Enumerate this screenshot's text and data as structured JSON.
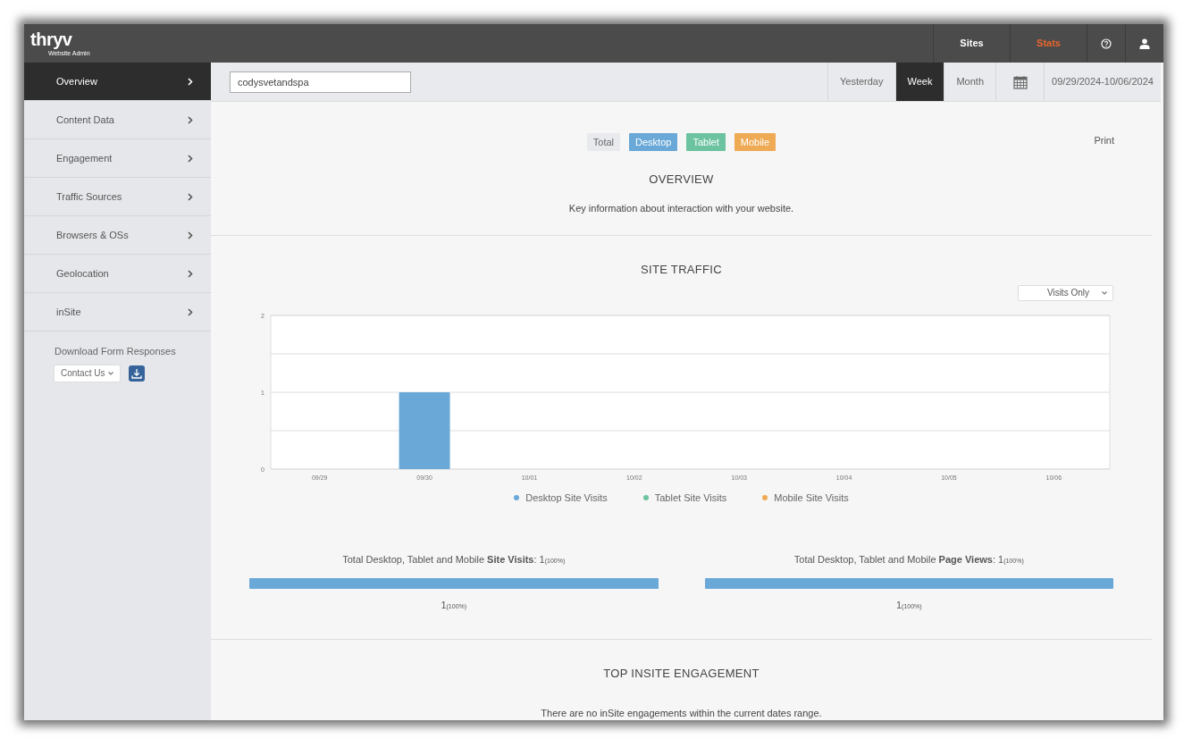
{
  "logo": {
    "name": "thryv",
    "tagline": "Website Admin"
  },
  "top_nav": [
    {
      "label": "Sites",
      "selected": false
    },
    {
      "label": "Stats",
      "selected": true
    }
  ],
  "sidebar": {
    "items": [
      {
        "label": "Overview",
        "selected": true
      },
      {
        "label": "Content Data",
        "selected": false
      },
      {
        "label": "Engagement",
        "selected": false
      },
      {
        "label": "Traffic Sources",
        "selected": false
      },
      {
        "label": "Browsers & OSs",
        "selected": false
      },
      {
        "label": "Geolocation",
        "selected": false
      },
      {
        "label": "inSite",
        "selected": false
      }
    ],
    "download": {
      "title": "Download Form Responses",
      "form_select": "Contact Us"
    }
  },
  "toolbar": {
    "site_field": "codysvetandspa",
    "ranges": [
      {
        "label": "Yesterday",
        "selected": false
      },
      {
        "label": "Week",
        "selected": true
      },
      {
        "label": "Month",
        "selected": false
      }
    ],
    "date_range": "09/29/2024-10/06/2024"
  },
  "device_filters": [
    {
      "label": "Total",
      "color": "#e9eaed"
    },
    {
      "label": "Desktop",
      "color": "#6aa8d8"
    },
    {
      "label": "Tablet",
      "color": "#6cc3a0"
    },
    {
      "label": "Mobile",
      "color": "#eeaa55"
    }
  ],
  "print": "Print",
  "overview": {
    "title": "OVERVIEW",
    "description": "Key information about interaction with your website."
  },
  "site_traffic": {
    "title": "SITE TRAFFIC",
    "mode_select": "Visits Only",
    "chart_data": {
      "type": "bar",
      "categories": [
        "09/29",
        "09/30",
        "10/01",
        "10/02",
        "10/03",
        "10/04",
        "10/05",
        "10/06"
      ],
      "series": [
        {
          "name": "Desktop Site Visits",
          "color": "#6aa8d8",
          "values": [
            0,
            1,
            0,
            0,
            0,
            0,
            0,
            0
          ]
        },
        {
          "name": "Tablet Site Visits",
          "color": "#6cc3a0",
          "values": [
            0,
            0,
            0,
            0,
            0,
            0,
            0,
            0
          ]
        },
        {
          "name": "Mobile Site Visits",
          "color": "#eeaa55",
          "values": [
            0,
            0,
            0,
            0,
            0,
            0,
            0,
            0
          ]
        }
      ],
      "ylim": [
        0,
        2
      ],
      "yticks": [
        0,
        1,
        2
      ]
    }
  },
  "totals": [
    {
      "label": "Total Desktop, Tablet and Mobile **Site Visits**:",
      "value": "1",
      "percent": "(100%)",
      "level": 1,
      "bar_value": "1",
      "bar_percent": "(100%)"
    },
    {
      "label": "Total Desktop, Tablet and Mobile **Page Views**:",
      "value": "1",
      "percent": "(100%)",
      "level": 1,
      "bar_value": "1",
      "bar_percent": "(100%)"
    }
  ],
  "top_insite": {
    "title": "TOP INSITE ENGAGEMENT",
    "message": "There are no inSite engagements within the current dates range."
  }
}
